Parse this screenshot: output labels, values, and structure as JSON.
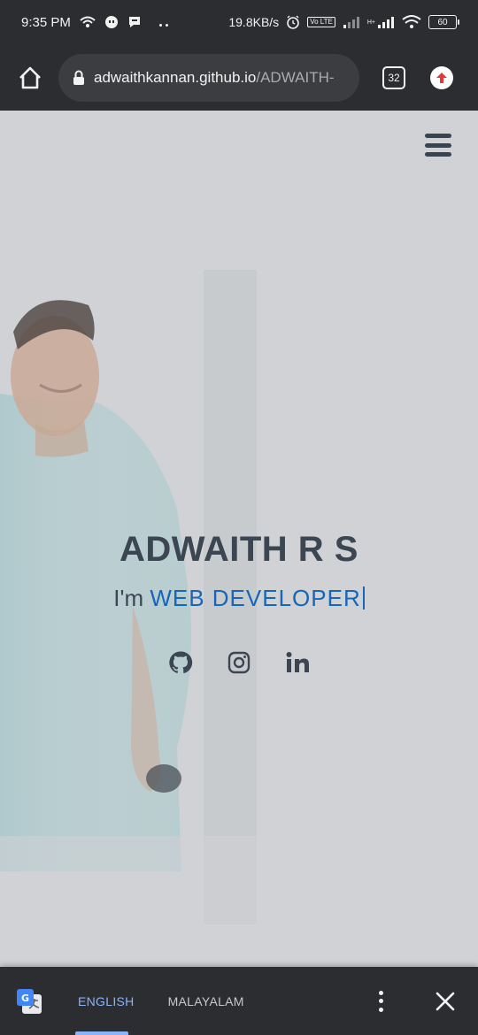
{
  "status_bar": {
    "time": "9:35 PM",
    "net_speed": "19.8KB/s",
    "lte_label": "Vo LTE",
    "battery": "60",
    "network_label": "H+"
  },
  "browser": {
    "url_domain": "adwaithkannan.github.io",
    "url_path": "/ADWAITH-",
    "tab_count": "32",
    "icons": [
      "home-icon",
      "lock-icon",
      "tabs-icon",
      "upload-icon"
    ]
  },
  "hero": {
    "name": "ADWAITH R S",
    "prefix": "I'm ",
    "role": "WEB DEVELOPER",
    "social": [
      "github-icon",
      "instagram-icon",
      "linkedin-icon"
    ]
  },
  "translate_bar": {
    "lang_source": "ENGLISH",
    "lang_target": "MALAYALAM"
  },
  "colors": {
    "chrome_bg": "#2b2d30",
    "page_bg": "#d0d2d5",
    "accent": "#1766b8",
    "text_dark": "#3c4652",
    "translate_active": "#8ab4f8"
  }
}
